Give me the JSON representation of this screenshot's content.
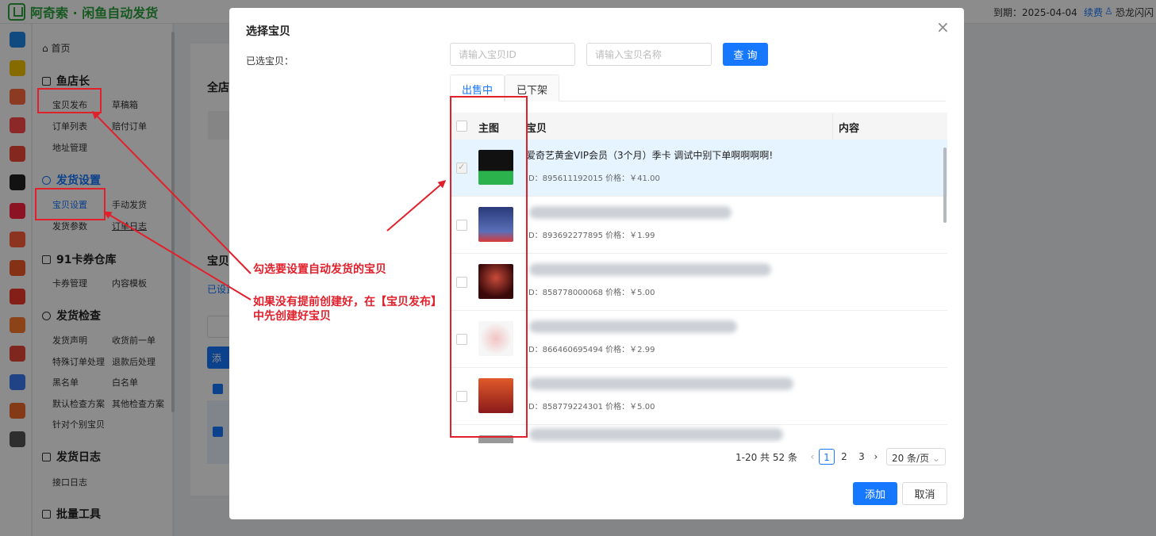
{
  "topbar": {
    "brand": "阿奇索 · 闲鱼自动发货",
    "expire": "到期：2025-04-04",
    "renew": "续费",
    "user": "恐龙闪闪"
  },
  "sidebar": {
    "home": "首页",
    "groups": [
      {
        "title": "鱼店长",
        "items": [
          "宝贝发布",
          "草稿箱",
          "订单列表",
          "赔付订单",
          "地址管理"
        ]
      },
      {
        "title": "发货设置",
        "items": [
          "宝贝设置",
          "手动发货",
          "发货参数",
          "订单日志"
        ]
      },
      {
        "title": "91卡券仓库",
        "items": [
          "卡券管理",
          "内容模板"
        ]
      },
      {
        "title": "发货检查",
        "items": [
          "发货声明",
          "收货前一单",
          "特殊订单处理",
          "退款后处理",
          "黑名单",
          "白名单",
          "默认检查方案",
          "其他检查方案",
          "针对个别宝贝"
        ]
      },
      {
        "title": "发货日志",
        "items": [
          "接口日志"
        ]
      },
      {
        "title": "批量工具",
        "items": []
      }
    ]
  },
  "background": {
    "heading": "全店",
    "section": "宝贝",
    "tab": "已设置",
    "add": "添"
  },
  "modal": {
    "title": "选择宝贝",
    "selected_label": "已选宝贝：",
    "id_placeholder": "请输入宝贝ID",
    "name_placeholder": "请输入宝贝名称",
    "query": "查 询",
    "tabs": [
      "出售中",
      "已下架"
    ],
    "columns": {
      "image": "主图",
      "item": "宝贝",
      "content": "内容"
    },
    "rows": [
      {
        "name": "爱奇艺黄金VIP会员（3个月）季卡 调试中别下单啊啊啊啊!",
        "meta": "ID：895611192015  价格：￥41.00",
        "checked": true,
        "selected": true
      },
      {
        "name": "",
        "meta": "ID：893692277895  价格：￥1.99",
        "checked": false,
        "selected": false
      },
      {
        "name": "",
        "meta": "ID：858778000068  价格：￥5.00",
        "checked": false,
        "selected": false
      },
      {
        "name": "",
        "meta": "ID：866460695494  价格：￥2.99",
        "checked": false,
        "selected": false
      },
      {
        "name": "",
        "meta": "ID：858779224301  价格：￥5.00",
        "checked": false,
        "selected": false
      }
    ],
    "pagination": {
      "summary": "1-20 共 52 条",
      "pages": [
        "1",
        "2",
        "3"
      ],
      "current": "1",
      "page_size": "20 条/页"
    },
    "add": "添加",
    "cancel": "取消"
  },
  "annotation": {
    "line1": "勾选要设置自动发货的宝贝",
    "line2": "如果没有提前创建好，在【宝贝发布】",
    "line3": "中先创建好宝贝"
  },
  "colors": {
    "accent": "#1677ff",
    "brand": "#2aa23c",
    "annotation": "#e0212c"
  }
}
